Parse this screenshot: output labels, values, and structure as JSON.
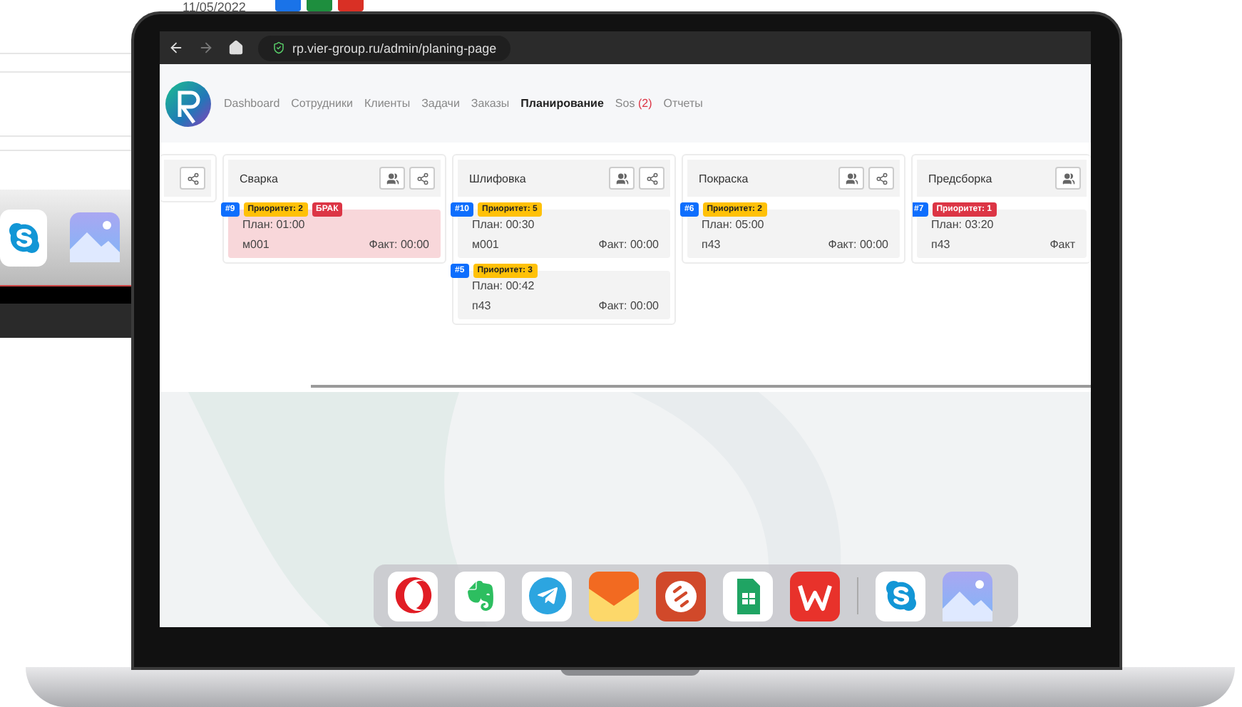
{
  "background_page": {
    "date": "11/05/2022"
  },
  "browser": {
    "url": "rp.vier-group.ru/admin/planing-page"
  },
  "nav": [
    {
      "label": "Dashboard",
      "selected": false
    },
    {
      "label": "Сотрудники",
      "selected": false
    },
    {
      "label": "Клиенты",
      "selected": false
    },
    {
      "label": "Задачи",
      "selected": false
    },
    {
      "label": "Заказы",
      "selected": false
    },
    {
      "label": "Планирование",
      "selected": true
    },
    {
      "label": "Sos",
      "count": "(2)",
      "selected": false
    },
    {
      "label": "Отчеты",
      "selected": false
    }
  ],
  "columns": [
    {
      "kind": "stub"
    },
    {
      "kind": "full",
      "title": "Сварка",
      "tasks": [
        {
          "number": "#9",
          "priority": "Приоритет: 2",
          "color": "#ffc107",
          "flag": "БРАК",
          "defect": true,
          "plan": "План: 01:00",
          "code": "м001",
          "fact": "Факт: 00:00"
        }
      ]
    },
    {
      "kind": "full",
      "title": "Шлифовка",
      "tasks": [
        {
          "number": "#10",
          "priority": "Приоритет: 5",
          "color": "#ffc107",
          "defect": false,
          "plan": "План: 00:30",
          "code": "м001",
          "fact": "Факт: 00:00"
        },
        {
          "number": "#5",
          "priority": "Приоритет: 3",
          "color": "#ffc107",
          "defect": false,
          "plan": "План: 00:42",
          "code": "п43",
          "fact": "Факт: 00:00"
        }
      ]
    },
    {
      "kind": "full",
      "title": "Покраска",
      "tasks": [
        {
          "number": "#6",
          "priority": "Приоритет: 2",
          "color": "#ffc107",
          "defect": false,
          "plan": "План: 05:00",
          "code": "п43",
          "fact": "Факт: 00:00"
        }
      ]
    },
    {
      "kind": "cut",
      "title": "Предсборка",
      "tasks": [
        {
          "number": "#7",
          "priority": "Приоритет: 1",
          "color": "#dc3545",
          "defect": false,
          "plan": "План: 03:20",
          "code": "п43",
          "fact": "Факт"
        }
      ]
    }
  ]
}
